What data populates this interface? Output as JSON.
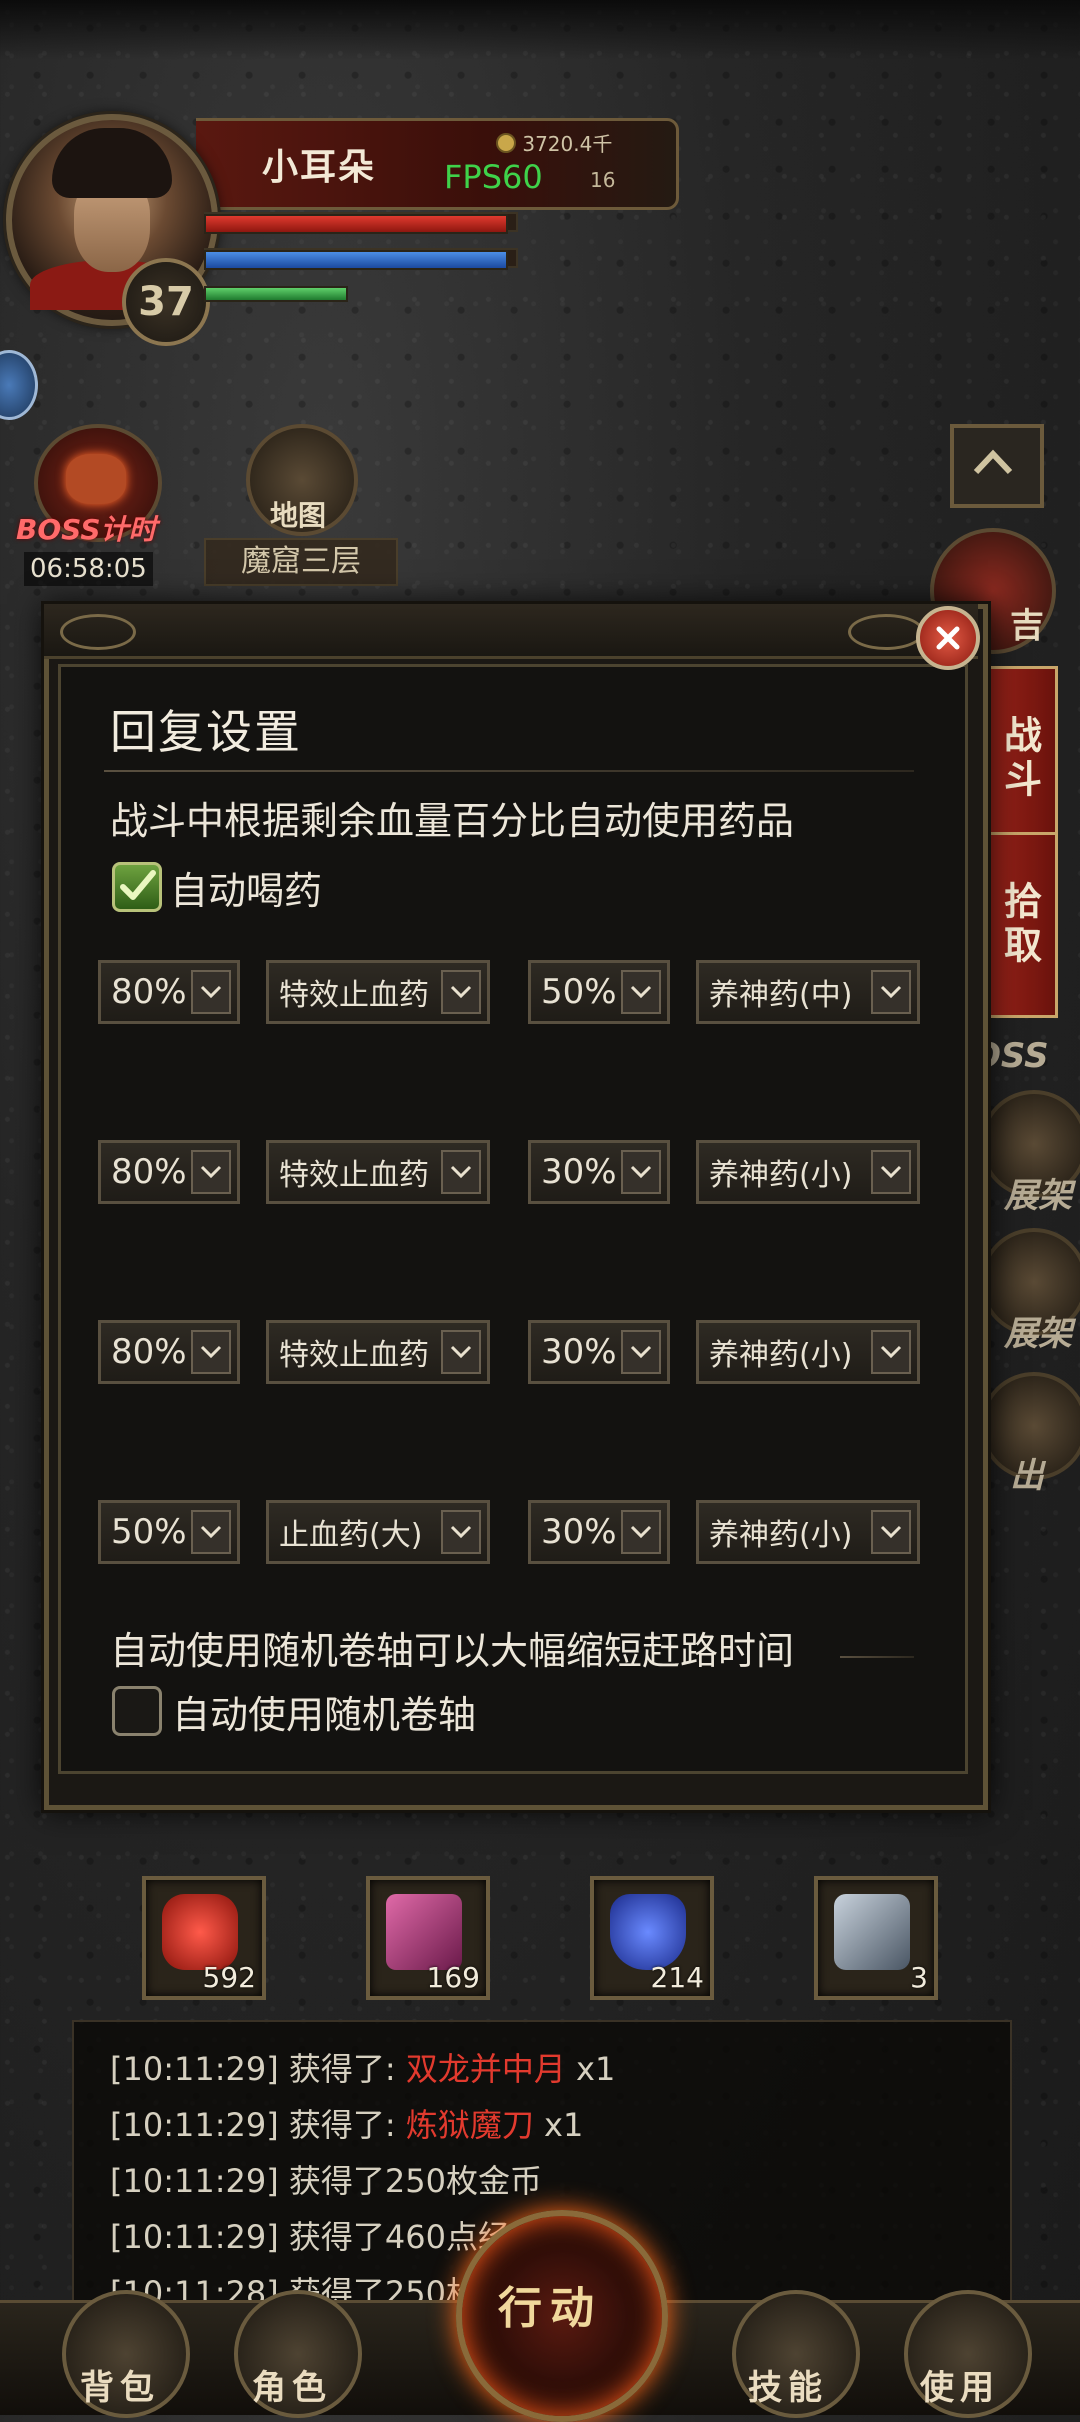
{
  "player": {
    "name": "小耳朵",
    "gold": "3720.4千",
    "fps": "FPS60",
    "small_value": "16",
    "level": "37"
  },
  "hud": {
    "boss_timer_label": "BOSS计时",
    "boss_timer_value": "06:58:05",
    "map_icon_label": "地图",
    "map_name": "魔窟三层",
    "notice_label": "吉",
    "side_tabs": {
      "battle": "战斗",
      "pickup": "拾取"
    },
    "side_ghost": [
      "OSS",
      "展架",
      "展架",
      "出"
    ]
  },
  "modal": {
    "title": "回复设置",
    "description": "战斗中根据剩余血量百分比自动使用药品",
    "auto_drink_label": "自动喝药",
    "auto_drink_checked": true,
    "rows": [
      {
        "hp_pct": "80%",
        "hp_item": "特效止血药",
        "mp_pct": "50%",
        "mp_item": "养神药(中)"
      },
      {
        "hp_pct": "80%",
        "hp_item": "特效止血药",
        "mp_pct": "30%",
        "mp_item": "养神药(小)"
      },
      {
        "hp_pct": "80%",
        "hp_item": "特效止血药",
        "mp_pct": "30%",
        "mp_item": "养神药(小)"
      },
      {
        "hp_pct": "50%",
        "hp_item": "止血药(大)",
        "mp_pct": "30%",
        "mp_item": "养神药(小)"
      }
    ],
    "scroll_description": "自动使用随机卷轴可以大幅缩短赶路时间",
    "auto_scroll_label": "自动使用随机卷轴",
    "auto_scroll_checked": false
  },
  "quick_items": [
    {
      "name": "red-potion",
      "count": "592",
      "color": "#b0221a"
    },
    {
      "name": "scroll-bundle",
      "count": "169",
      "color": "#c23a7a"
    },
    {
      "name": "blue-potion",
      "count": "214",
      "color": "#2a4fd0"
    },
    {
      "name": "iron-scroll",
      "count": "3",
      "color": "#8a98a8"
    }
  ],
  "chat": [
    {
      "time": "[10:11:29]",
      "text": "获得了: ",
      "item": "双龙并中月",
      "suffix": " x1"
    },
    {
      "time": "[10:11:29]",
      "text": "获得了: ",
      "item": "炼狱魔刀",
      "suffix": " x1"
    },
    {
      "time": "[10:11:29]",
      "text": "获得了250枚金币",
      "item": "",
      "suffix": ""
    },
    {
      "time": "[10:11:29]",
      "text": "获得了460点经",
      "item": "",
      "suffix": ""
    },
    {
      "time": "[10:11:28]",
      "text": "获得了250枚",
      "item": "",
      "suffix": ""
    }
  ],
  "bottom_nav": {
    "bag": "背包",
    "character": "角色",
    "action": "行动",
    "skills": "技能",
    "use": "使用"
  }
}
